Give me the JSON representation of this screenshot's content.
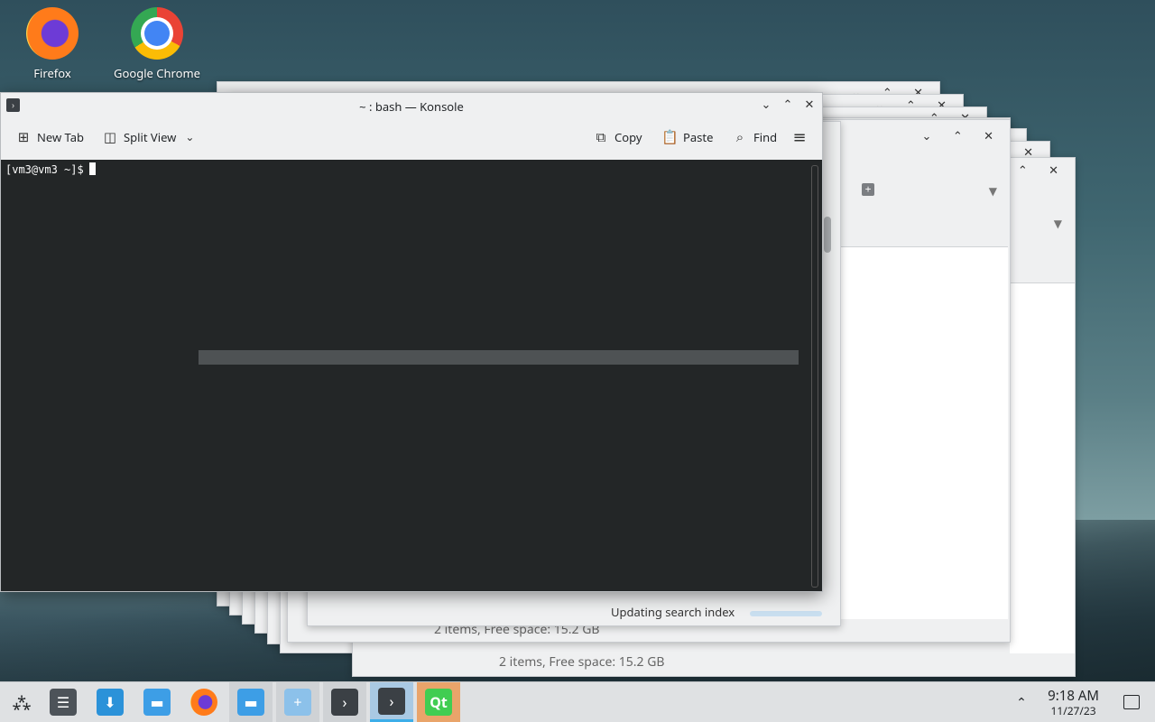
{
  "desktop": {
    "icons": [
      {
        "label": "Firefox"
      },
      {
        "label": "Google Chrome"
      }
    ]
  },
  "konsole": {
    "title": "~ : bash — Konsole",
    "toolbar": {
      "new_tab": "New Tab",
      "split_view": "Split View",
      "copy": "Copy",
      "paste": "Paste",
      "find": "Find"
    },
    "prompt": "[vm3@vm3 ~]$"
  },
  "background_windows": {
    "status_1": "2 items, Free space: 15.2 GB",
    "status_2": "2 items, Free space: 15.2 GB",
    "status_3": "Updating search index"
  },
  "taskbar": {
    "time": "9:18 AM",
    "date": "11/27/23"
  }
}
